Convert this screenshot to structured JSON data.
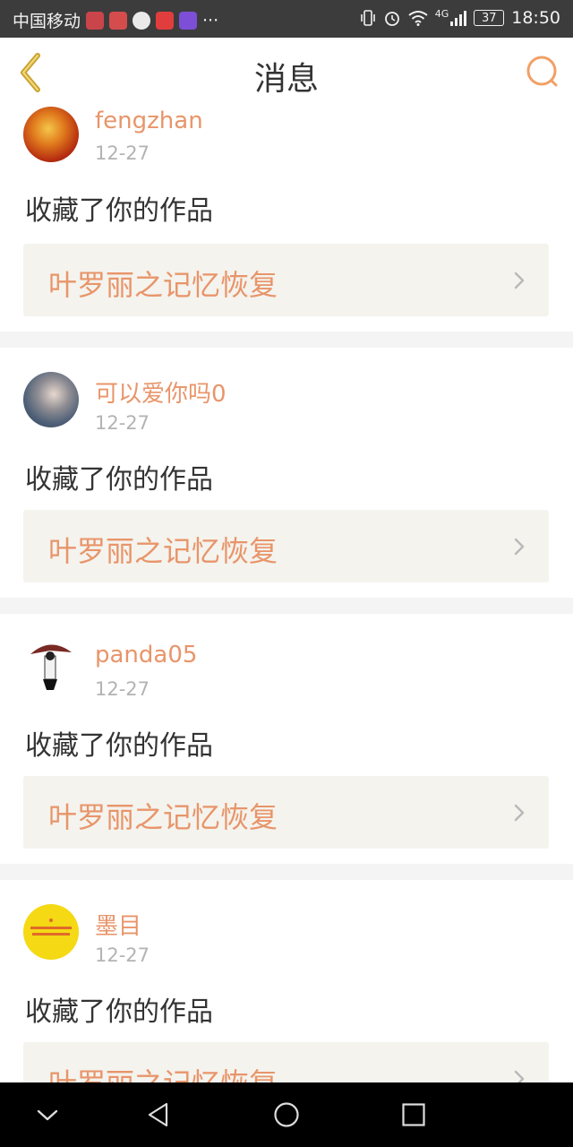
{
  "status_bar": {
    "carrier": "中国移动",
    "more": "···",
    "network": "4G",
    "battery": "37",
    "time": "18:50"
  },
  "header": {
    "title": "消息",
    "back_icon": "chevron-left-icon",
    "search_icon": "search-icon"
  },
  "colors": {
    "accent": "#e8956a",
    "work_bg": "#f4f3ee",
    "divider": "#f4f4f4"
  },
  "messages": [
    {
      "username": "fengzhan",
      "date": "12-27",
      "action": "收藏了你的作品",
      "work_title": "叶罗丽之记忆恢复"
    },
    {
      "username": "可以爱你吗0",
      "date": "12-27",
      "action": "收藏了你的作品",
      "work_title": "叶罗丽之记忆恢复"
    },
    {
      "username": "panda05",
      "date": "12-27",
      "action": "收藏了你的作品",
      "work_title": "叶罗丽之记忆恢复"
    },
    {
      "username": "墨目",
      "date": "12-27",
      "action": "收藏了你的作品",
      "work_title": "叶罗丽之记忆恢复"
    }
  ],
  "nav_bar": [
    "collapse-icon",
    "back-triangle-icon",
    "home-circle-icon",
    "recents-square-icon"
  ]
}
